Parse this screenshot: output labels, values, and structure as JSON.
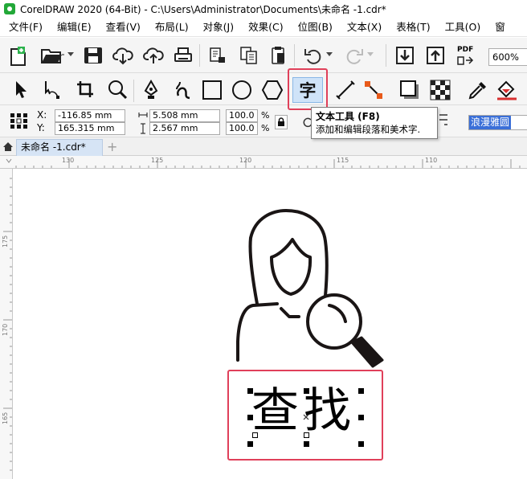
{
  "window": {
    "title": "CorelDRAW 2020 (64-Bit) - C:\\Users\\Administrator\\Documents\\未命名 -1.cdr*"
  },
  "menu": [
    {
      "label": "文件(F)"
    },
    {
      "label": "编辑(E)"
    },
    {
      "label": "查看(V)"
    },
    {
      "label": "布局(L)"
    },
    {
      "label": "对象(J)"
    },
    {
      "label": "效果(C)"
    },
    {
      "label": "位图(B)"
    },
    {
      "label": "文本(X)"
    },
    {
      "label": "表格(T)"
    },
    {
      "label": "工具(O)"
    },
    {
      "label": "窗"
    }
  ],
  "standard_toolbar": {
    "zoom": "600%",
    "pdf_label": "PDF"
  },
  "property_bar": {
    "x_label": "X:",
    "x_value": "-116.85 mm",
    "y_label": "Y:",
    "y_value": "165.315 mm",
    "width_value": "5.508 mm",
    "height_value": "2.567 mm",
    "scale_x": "100.0",
    "scale_y": "100.0",
    "percent": "%",
    "font_name": "浪漫雅圆"
  },
  "tooltip": {
    "title": "文本工具 (F8)",
    "description": "添加和编辑段落和美术字."
  },
  "document_tabs": [
    {
      "label": "未命名 -1.cdr*"
    }
  ],
  "ruler": {
    "horizontal": [
      "130",
      "125",
      "120",
      "115",
      "110"
    ],
    "vertical": [
      "175",
      "170",
      "165"
    ]
  },
  "canvas": {
    "text": "查找"
  },
  "colors": {
    "highlight": "#e0405a",
    "tab_active": "#d6e4f5",
    "app_green": "#22a838"
  },
  "icons": [
    "app-logo-icon",
    "new-document-icon",
    "open-folder-icon",
    "save-icon",
    "cloud-download-icon",
    "cloud-upload-icon",
    "print-icon",
    "undo-icon",
    "redo-icon",
    "import-icon",
    "export-icon",
    "pick-tool-icon",
    "shape-tool-icon",
    "crop-tool-icon",
    "zoom-tool-icon",
    "pen-tool-icon",
    "artistic-media-icon",
    "rectangle-tool-icon",
    "ellipse-tool-icon",
    "polygon-tool-icon",
    "text-tool-icon",
    "dimension-tool-icon",
    "connector-tool-icon",
    "drop-shadow-icon",
    "transparency-icon",
    "eyedropper-icon",
    "fill-icon",
    "lock-icon",
    "home-icon"
  ]
}
